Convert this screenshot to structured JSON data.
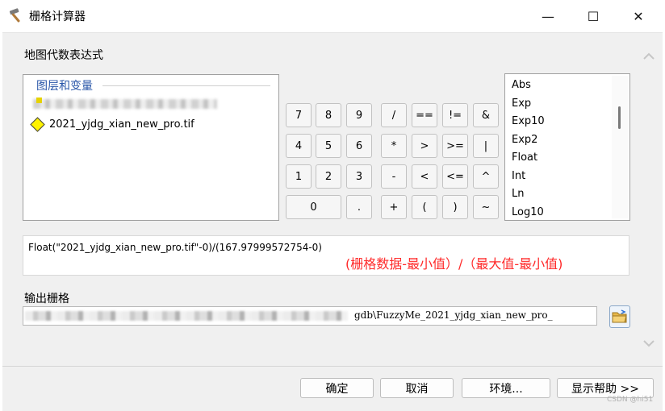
{
  "window": {
    "title": "栅格计算器",
    "minimize_glyph": "—",
    "maximize_glyph": "☐",
    "close_glyph": "✕"
  },
  "labels": {
    "map_algebra": "地图代数表达式",
    "output_raster": "输出栅格"
  },
  "layers": {
    "group_title": "图层和变量",
    "items": [
      "2021_yjdg_xian_new_pro.tif"
    ]
  },
  "calculator": {
    "buttons": [
      "7",
      "8",
      "9",
      "/",
      "==",
      "!=",
      "&",
      "4",
      "5",
      "6",
      "*",
      ">",
      ">=",
      "|",
      "1",
      "2",
      "3",
      "-",
      "<",
      "<=",
      "^",
      "0",
      ".",
      "+",
      "(",
      ")",
      "~"
    ]
  },
  "functions": [
    "Abs",
    "Exp",
    "Exp10",
    "Exp2",
    "Float",
    "Int",
    "Ln",
    "Log10"
  ],
  "expression": {
    "text": "Float(\"2021_yjdg_xian_new_pro.tif\"-0)/(167.97999572754-0)",
    "annotation": "(栅格数据-最小值）/（最大值-最小值)"
  },
  "output": {
    "visible_value": "gdb\\FuzzyMe_2021_yjdg_xian_new_pro_"
  },
  "dialog_buttons": {
    "ok": "确定",
    "cancel": "取消",
    "environments": "环境...",
    "show_help": "显示帮助 >>"
  },
  "watermark": "CSDN @hi51",
  "colors": {
    "annotation": "#ff2a2a",
    "group_title": "#2956a8"
  }
}
